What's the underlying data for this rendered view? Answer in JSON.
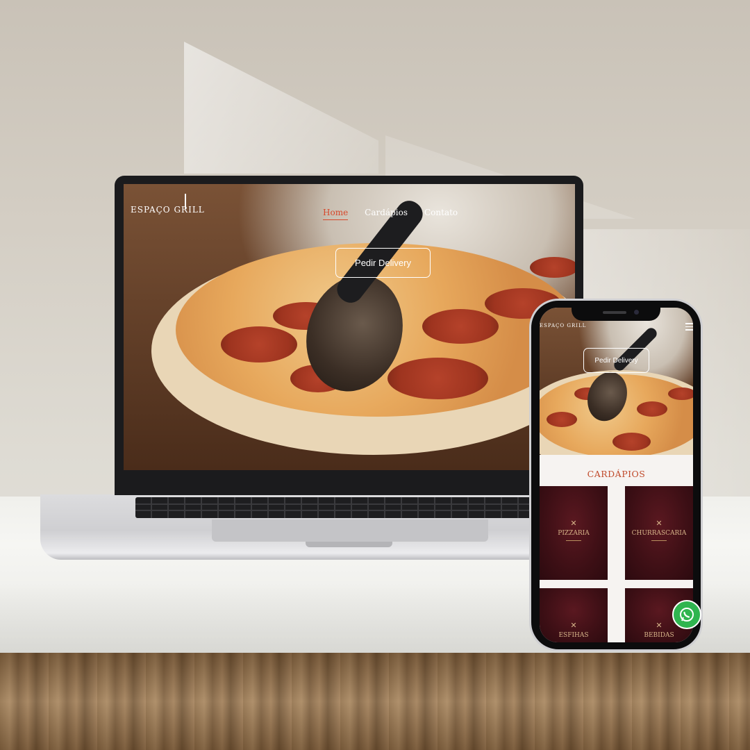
{
  "brand": {
    "logo_text": "ESPAÇO GRILL"
  },
  "laptop_site": {
    "nav": {
      "home": "Home",
      "cardapios": "Cardápios",
      "contato": "Contato"
    },
    "cta": "Pedir Delivery"
  },
  "phone_site": {
    "cta": "Pedir Delivery",
    "section_title": "CARDÁPIOS",
    "tiles": [
      "PIZZARIA",
      "CHURRASCARIA",
      "ESFIHAS",
      "BEBIDAS"
    ],
    "tile_icon": "crossed-cutlery-icon"
  },
  "colors": {
    "accent": "#d6472a",
    "tile_bg": "#3d0f15",
    "tile_text": "#d7b58a",
    "whatsapp": "#2fb54f"
  }
}
